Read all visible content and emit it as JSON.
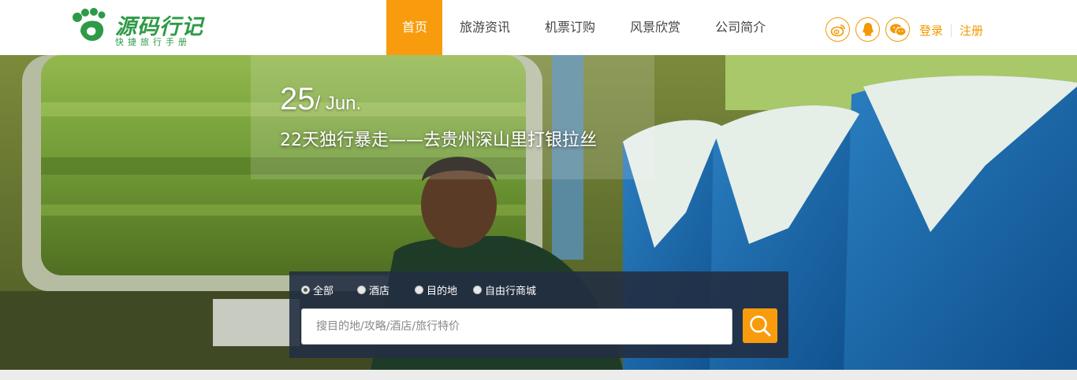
{
  "logo": {
    "title": "源码行记",
    "subtitle": "快捷旅行手册",
    "icon": "footprint-logo-icon",
    "color": "#2e9a47"
  },
  "nav": {
    "items": [
      {
        "label": "首页",
        "active": true
      },
      {
        "label": "旅游资讯",
        "active": false
      },
      {
        "label": "机票订购",
        "active": false
      },
      {
        "label": "风景欣赏",
        "active": false
      },
      {
        "label": "公司简介",
        "active": false
      }
    ],
    "active_color": "#f89c0e"
  },
  "social": {
    "icons": [
      "weibo-icon",
      "qq-icon",
      "wechat-icon"
    ],
    "color": "#f39800"
  },
  "auth": {
    "login": "登录",
    "register": "注册"
  },
  "banner": {
    "day": "25",
    "month": "/ Jun.",
    "headline": "22天独行暴走——去贵州深山里打银拉丝"
  },
  "search": {
    "options": [
      {
        "label": "全部",
        "selected": true
      },
      {
        "label": "酒店",
        "selected": false
      },
      {
        "label": "目的地",
        "selected": false
      },
      {
        "label": "自由行商城",
        "selected": false
      }
    ],
    "placeholder": "搜目的地/攻略/酒店/旅行特价",
    "value": "",
    "button_icon": "search-icon",
    "button_color": "#f89c0e"
  }
}
